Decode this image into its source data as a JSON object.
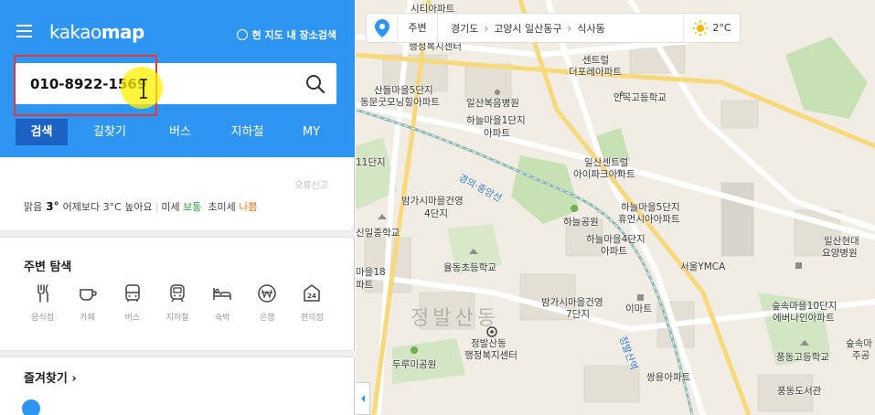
{
  "app": {
    "logo_part1": "kakao",
    "logo_part2": "map",
    "area_search": "현 지도 내 장소검색"
  },
  "search": {
    "value": "010-8922-1569",
    "placeholder": ""
  },
  "tabs": [
    {
      "label": "검색",
      "active": true
    },
    {
      "label": "길찾기"
    },
    {
      "label": "버스"
    },
    {
      "label": "지하철"
    },
    {
      "label": "MY"
    }
  ],
  "weather": {
    "report": "오류신고",
    "condition": "맑음",
    "temp": "3°",
    "compare": "어제보다 3°C 높아요",
    "fine_dust_label": "미세",
    "fine_dust_value": "보통",
    "ultra_dust_label": "초미세",
    "ultra_dust_value": "나쁨"
  },
  "nearby": {
    "title": "주변 탐색",
    "categories": [
      {
        "label": "음식점",
        "icon": "restaurant-icon"
      },
      {
        "label": "카페",
        "icon": "cafe-icon"
      },
      {
        "label": "버스",
        "icon": "bus-icon"
      },
      {
        "label": "지하철",
        "icon": "subway-icon"
      },
      {
        "label": "숙박",
        "icon": "lodging-icon"
      },
      {
        "label": "은행",
        "icon": "bank-icon"
      },
      {
        "label": "편의점",
        "icon": "convenience-store-icon"
      }
    ]
  },
  "favorites": {
    "title": "즐겨찾기 ›"
  },
  "map_header": {
    "nearby": "주변",
    "crumb1": "경기도",
    "crumb2": "고양시 일산동구",
    "crumb3": "식사동",
    "chevron": "›",
    "temp": "2°C"
  },
  "map_labels": {
    "l1": "시티아파트",
    "l2": "행정복지센터",
    "l3": "산들마을5단지",
    "l4": "동문굿모닝힐아파트",
    "l5": "일산복음병원",
    "l6": "센트럴",
    "l7": "더포레아파트",
    "l8": "안곡고등학교",
    "l9": "하늘마을1단지",
    "l10": "아파트",
    "l11": "11단지",
    "l12": "일산센트럴",
    "l13": "아이파크아파트",
    "l14": "밤가시마을건영",
    "l15": "4단지",
    "l16": "하늘마을5단지",
    "l17": "휴먼시아아파트",
    "l18": "하늘공원",
    "l19": "신일중학교",
    "l20": "하늘마을4단지",
    "l21": "아파트",
    "l22": "일산현대",
    "l23": "요양병원",
    "l24": "율동초등학교",
    "l25": "서울YMCA",
    "l26": "밤가시마을건영",
    "l27": "7단지",
    "l28": "이마트",
    "l29": "숲속마을10단지",
    "l30": "에버나인아파트",
    "l31": "정발산동",
    "l32": "행정복지센터",
    "l33": "숲속마",
    "l34": "주공",
    "l35": "두루미공원",
    "l36": "쌍용아파트",
    "l37": "풍동고등학교",
    "l38": "풍동도서관",
    "l39": "경의·중앙선",
    "l40": "정발산역",
    "l41": "마을18",
    "l42": "파트",
    "district": "정발산동"
  },
  "colors": {
    "brand_blue": "#2f95f3",
    "active_tab": "#1c62c2",
    "highlight_red": "#e53935",
    "cursor_yellow": "#fff000"
  }
}
